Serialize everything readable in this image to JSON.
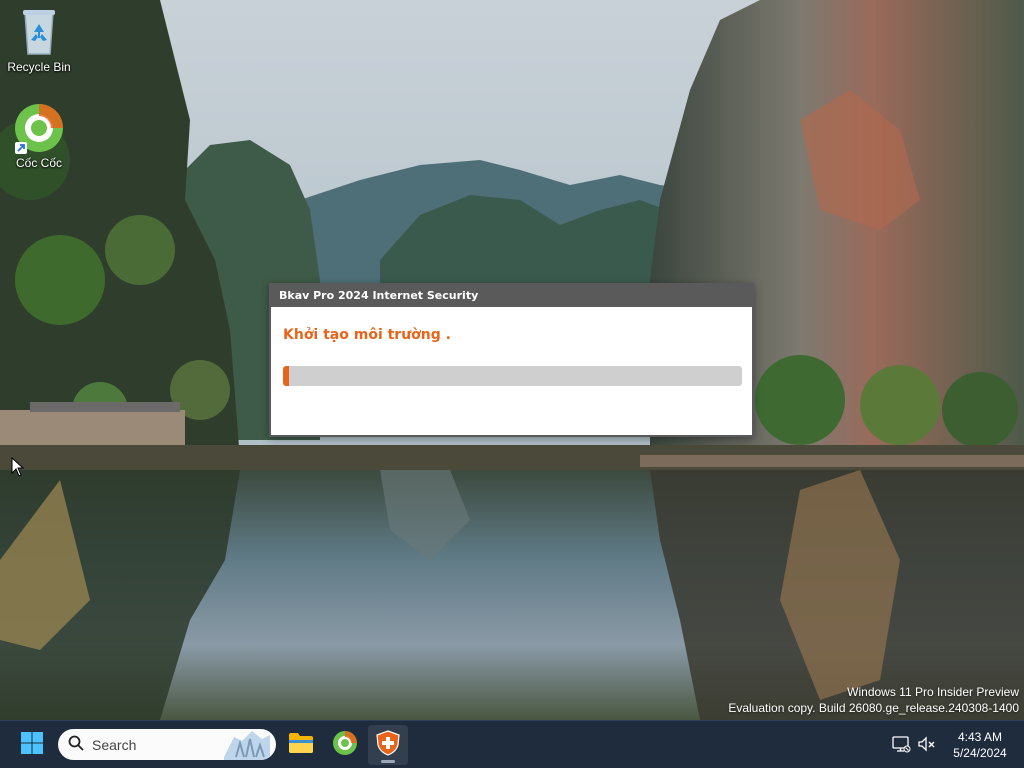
{
  "desktop": {
    "icons": [
      {
        "label": "Recycle Bin",
        "icon": "recycle-bin-icon"
      },
      {
        "label": "Cốc Cốc",
        "icon": "coccoc-browser-icon"
      }
    ]
  },
  "dialog": {
    "title": "Bkav Pro 2024 Internet Security",
    "status": "Khởi tạo môi trường .",
    "progress": 0.01,
    "accent": "#e8641a",
    "titlebar_color": "#5a5a5a"
  },
  "watermark": {
    "line1": "Windows 11 Pro Insider Preview",
    "line2": "Evaluation copy. Build 26080.ge_release.240308-1400"
  },
  "taskbar": {
    "background": "#1f2c3d",
    "start_icon": "windows-start-icon",
    "search_placeholder": "Search",
    "apps": [
      {
        "name": "File Explorer",
        "icon": "folder-icon"
      },
      {
        "name": "Cốc Cốc",
        "icon": "coccoc-browser-icon"
      },
      {
        "name": "Bkav Pro",
        "icon": "bkav-shield-icon",
        "active": true
      }
    ],
    "tray": [
      "network-icon",
      "volume-muted-icon"
    ],
    "time": "4:43 AM",
    "date": "5/24/2024"
  }
}
